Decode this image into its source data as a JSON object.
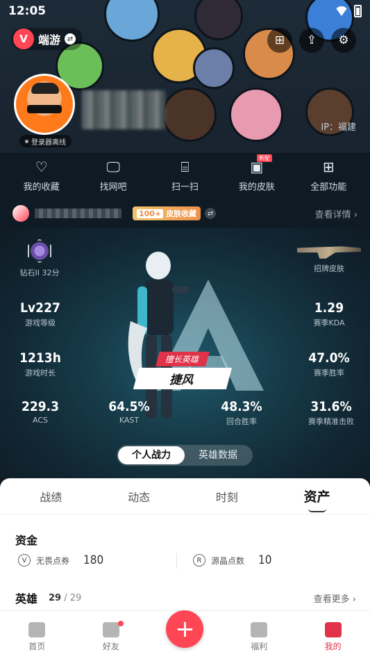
{
  "status_bar": {
    "time": "12:05"
  },
  "brand": {
    "name": "端游"
  },
  "profile": {
    "login_status": "登录器离线",
    "region": "IP：福建"
  },
  "quick_actions": [
    {
      "label": "我的收藏",
      "icon": "heart-icon"
    },
    {
      "label": "找网吧",
      "icon": "monitor-icon"
    },
    {
      "label": "扫一扫",
      "icon": "scan-icon"
    },
    {
      "label": "我的皮肤",
      "icon": "skin-icon",
      "tag": "新配"
    },
    {
      "label": "全部功能",
      "icon": "grid-icon"
    }
  ],
  "account": {
    "skin_badge_num": "100+",
    "skin_badge_text": "皮肤收藏",
    "detail": "查看详情 ›"
  },
  "stats": {
    "rank": {
      "value": "",
      "label": "钻石II 32分"
    },
    "skin": {
      "label": "招牌皮肤"
    },
    "level": {
      "value": "Lv227",
      "label": "游戏等级"
    },
    "kda": {
      "value": "1.29",
      "label": "赛季KDA"
    },
    "hours": {
      "value": "1213h",
      "label": "游戏时长"
    },
    "winrate": {
      "value": "47.0%",
      "label": "赛季胜率"
    },
    "acs": {
      "value": "229.3",
      "label": "ACS"
    },
    "kast": {
      "value": "64.5%",
      "label": "KAST"
    },
    "round_win": {
      "value": "48.3%",
      "label": "回合胜率"
    },
    "headshot": {
      "value": "31.6%",
      "label": "赛季精准击败"
    }
  },
  "hero": {
    "tag": "擅长英雄",
    "name": "捷风"
  },
  "toggle": {
    "active": "个人战力",
    "inactive": "英雄数据"
  },
  "tabs": [
    "战绩",
    "动态",
    "时刻",
    "资产"
  ],
  "funds": {
    "title": "资金",
    "items": [
      {
        "label": "无畏点券",
        "value": "180",
        "icon": "v-icon"
      },
      {
        "label": "源晶点数",
        "value": "10",
        "icon": "r-icon"
      }
    ]
  },
  "heroes": {
    "title": "英雄",
    "owned": "29",
    "total": "/ 29",
    "more": "查看更多 ›"
  },
  "nav": [
    {
      "label": "首页",
      "icon": "home-icon"
    },
    {
      "label": "好友",
      "icon": "friends-icon"
    },
    {
      "label": "",
      "icon": "plus-icon"
    },
    {
      "label": "福利",
      "icon": "gift-icon"
    },
    {
      "label": "我的",
      "icon": "profile-icon"
    }
  ],
  "colors": {
    "accent": "#ff4655",
    "active_nav": "#e0334a"
  }
}
